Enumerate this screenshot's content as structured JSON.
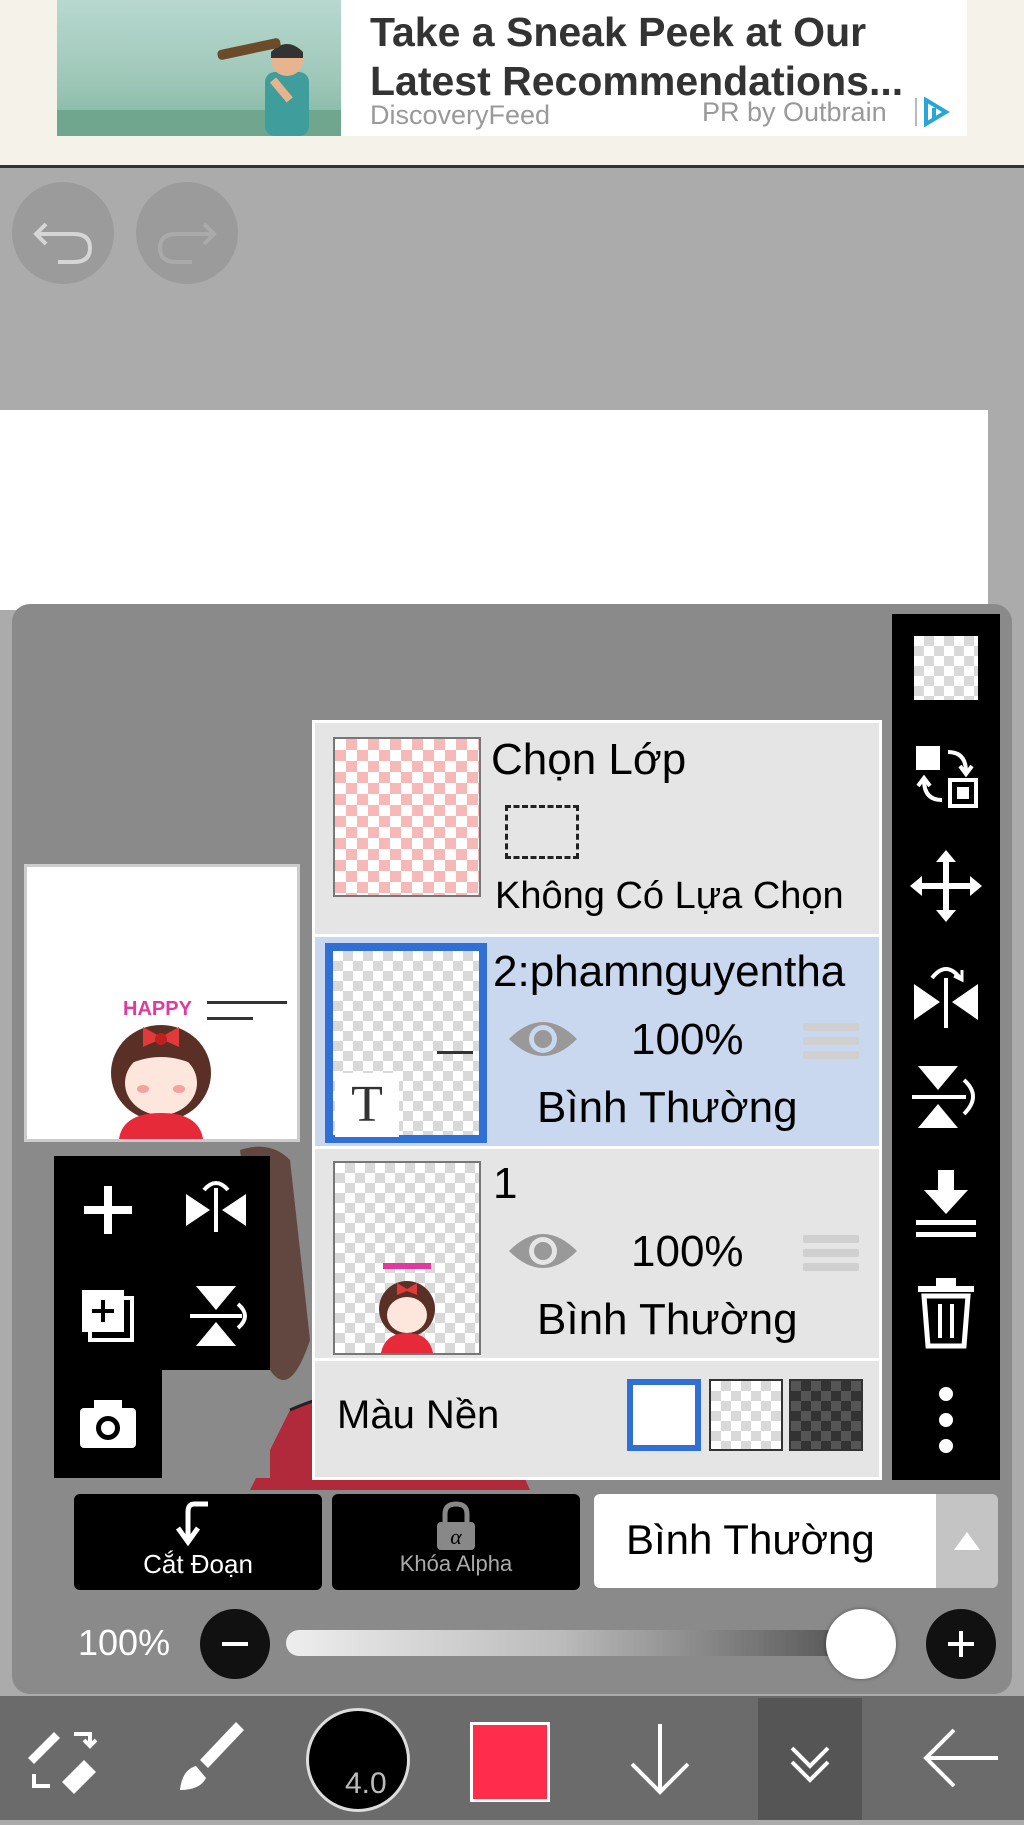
{
  "ad": {
    "title": "Take a Sneak Peek at Our Latest Recommendations...",
    "source": "DiscoveryFeed",
    "sponsor": "PR by Outbrain"
  },
  "layers": {
    "selection_layer": {
      "title": "Chọn Lớp",
      "status": "Không Có Lựa Chọn"
    },
    "items": [
      {
        "name": "2:phamnguyentha",
        "opacity": "100%",
        "blend": "Bình Thường",
        "type_icon": "T",
        "selected": true
      },
      {
        "name": "1",
        "opacity": "100%",
        "blend": "Bình Thường",
        "selected": false
      }
    ],
    "background_label": "Màu Nền"
  },
  "preview_art": {
    "happy_text": "HAPPY"
  },
  "controls": {
    "clipping_label": "Cắt Đoạn",
    "alpha_lock_label": "Khóa Alpha",
    "blend_mode": "Bình Thường",
    "opacity_label": "100%",
    "opacity_value": 1.0
  },
  "toolbar": {
    "brush_size": "4.0",
    "color": "#ff2d4b"
  }
}
